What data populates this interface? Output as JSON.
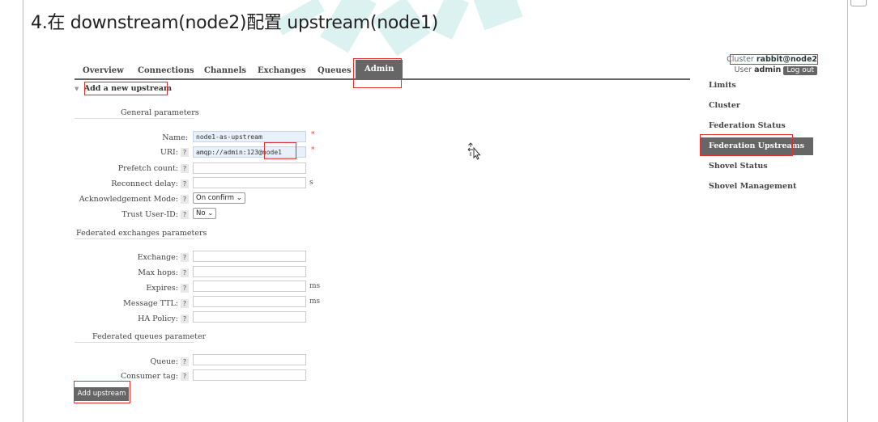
{
  "heading": "4.在 downstream(node2)配置 upstream(node1)",
  "nav": {
    "tabs": [
      "Overview",
      "Connections",
      "Channels",
      "Exchanges",
      "Queues",
      "Admin"
    ],
    "active_tab": "Admin"
  },
  "cluster": {
    "label": "Cluster",
    "name": "rabbit@node2",
    "user_label": "User",
    "user": "admin",
    "logout": "Log out"
  },
  "form": {
    "title": "Add a new upstream",
    "general_title": "General parameters",
    "name": {
      "label": "Name:",
      "value": "node1-as-upstream",
      "required": "*"
    },
    "uri": {
      "label": "URI:",
      "help": "?",
      "value": "amqp://admin:123@node1",
      "required": "*"
    },
    "prefetch": {
      "label": "Prefetch count:",
      "help": "?",
      "value": ""
    },
    "reconnect": {
      "label": "Reconnect delay:",
      "help": "?",
      "value": "",
      "unit": "s"
    },
    "ack_mode": {
      "label": "Acknowledgement Mode:",
      "help": "?",
      "selected": "On confirm"
    },
    "trust_user": {
      "label": "Trust User-ID:",
      "help": "?",
      "selected": "No"
    },
    "exchanges_title": "Federated exchanges parameters",
    "exchange": {
      "label": "Exchange:",
      "help": "?",
      "value": ""
    },
    "max_hops": {
      "label": "Max hops:",
      "help": "?",
      "value": ""
    },
    "expires": {
      "label": "Expires:",
      "help": "?",
      "value": "",
      "unit": "ms"
    },
    "message_ttl": {
      "label": "Message TTL:",
      "help": "?",
      "value": "",
      "unit": "ms"
    },
    "ha_policy": {
      "label": "HA Policy:",
      "help": "?",
      "value": ""
    },
    "queues_title": "Federated queues parameter",
    "queue": {
      "label": "Queue:",
      "help": "?",
      "value": ""
    },
    "consumer_tag": {
      "label": "Consumer tag:",
      "help": "?",
      "value": ""
    },
    "submit": "Add upstream"
  },
  "sidebar": {
    "items": [
      "Limits",
      "Cluster",
      "Federation Status",
      "Federation Upstreams",
      "Shovel Status",
      "Shovel Management"
    ],
    "active": "Federation Upstreams"
  },
  "colors": {
    "highlight": "#e03030",
    "active_tab_bg": "#666666",
    "required": "#e04040"
  }
}
